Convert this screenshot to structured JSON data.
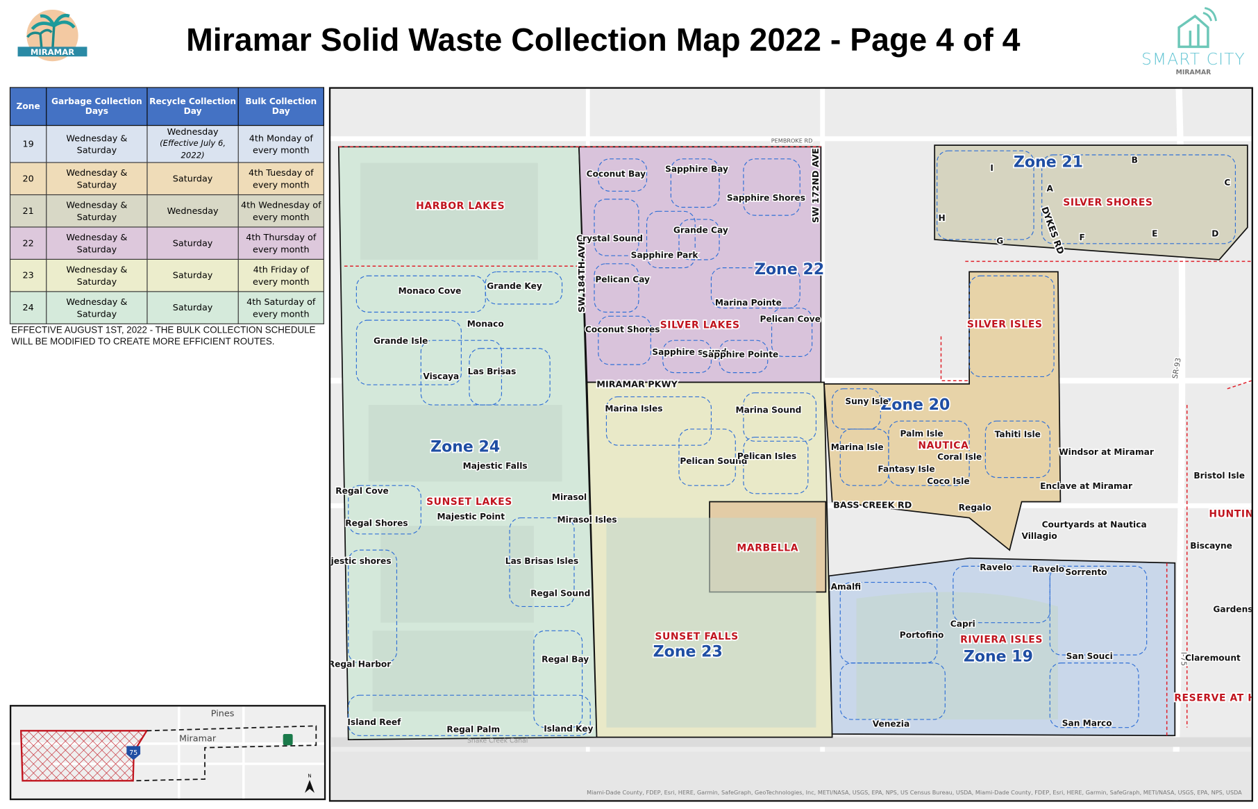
{
  "header": {
    "title": "Miramar Solid Waste Collection Map 2022 - Page 4 of 4",
    "left_logo_text": "MIRAMAR",
    "right_logo_text": "SMART CITY",
    "right_logo_subtext": "MIRAMAR"
  },
  "schedule_table": {
    "columns": [
      "Zone",
      "Garbage Collection Days",
      "Recycle Collection Day",
      "Bulk Collection Day"
    ],
    "rows": [
      {
        "zone": "19",
        "garbage": "Wednesday & Saturday",
        "recycle": "Wednesday",
        "recycle_note": "(Effective July 6, 2022)",
        "bulk": "4th Monday of every month",
        "color": "#dae3f0"
      },
      {
        "zone": "20",
        "garbage": "Wednesday & Saturday",
        "recycle": "Saturday",
        "bulk": "4th Tuesday of every month",
        "color": "#efdcb8"
      },
      {
        "zone": "21",
        "garbage": "Wednesday & Saturday",
        "recycle": "Wednesday",
        "bulk": "4th Wednesday of every month",
        "color": "#d8d8c6"
      },
      {
        "zone": "22",
        "garbage": "Wednesday & Saturday",
        "recycle": "Saturday",
        "bulk": "4th Thursday of every month",
        "color": "#ddc8dc"
      },
      {
        "zone": "23",
        "garbage": "Wednesday & Saturday",
        "recycle": "Saturday",
        "bulk": "4th Friday of every month",
        "color": "#ecedcc"
      },
      {
        "zone": "24",
        "garbage": "Wednesday & Saturday",
        "recycle": "Saturday",
        "bulk": "4th Saturday of every month",
        "color": "#d5eadb"
      }
    ],
    "header_color": "#4472c4"
  },
  "note": "EFFECTIVE AUGUST 1ST, 2022 - THE BULK COLLECTION SCHEDULE WILL BE MODIFIED TO CREATE MORE EFFICIENT ROUTES.",
  "map": {
    "zones": [
      "Zone 24",
      "Zone 22",
      "Zone 23",
      "Zone 20",
      "Zone 21",
      "Zone 19"
    ],
    "zone_colors": {
      "19": "#c9d7ea",
      "20": "#e7d3a8",
      "21": "#d6d4c0",
      "22": "#d9c3db",
      "23": "#e9e9c8",
      "24": "#d4e8da",
      "marbella": "#e3cca6"
    },
    "communities": [
      "HARBOR LAKES",
      "SILVER LAKES",
      "SUNSET LAKES",
      "NAUTICA",
      "SILVER ISLES",
      "SILVER SHORES",
      "MARBELLA",
      "SUNSET FALLS",
      "RIVIERA ISLES",
      "HUNTIN",
      "RESERVE AT H"
    ],
    "roads": [
      "MIRAMAR PKWY",
      "SW 184TH AVE",
      "SW 172ND AVE",
      "DYKES RD",
      "BASS CREEK RD",
      "PEMBROKE RD",
      "SR-93",
      "I-75"
    ],
    "neighborhoods": [
      "Coconut Bay",
      "Sapphire Bay",
      "Sapphire Shores",
      "Crystal Sound",
      "Grande Cay",
      "Sapphire Park",
      "Pelican Cay",
      "Marina Pointe",
      "Pelican Cove",
      "Coconut Shores",
      "Sapphire sound",
      "Sapphire Pointe",
      "Monaco Cove",
      "Grande Key",
      "Monaco",
      "Grande Isle",
      "Viscaya",
      "Las Brisas",
      "Majestic Falls",
      "Regal Cove",
      "Mirasol",
      "Majestic Point",
      "Mirasol Isles",
      "Regal Shores",
      "Majestic shores",
      "Las Brisas Isles",
      "Regal Sound",
      "Regal Harbor",
      "Regal Bay",
      "Island Reef",
      "Regal Palm",
      "Island Key",
      "Marina Isles",
      "Marina Sound",
      "Pelican Sound",
      "Pelican Isles",
      "Suny Isle",
      "Palm Isle",
      "Tahiti Isle",
      "Marina Isle",
      "Coral Isle",
      "Fantasy Isle",
      "Coco Isle",
      "Regalo",
      "Amalfi",
      "Ravelo",
      "Ravelo",
      "Sorrento",
      "Portofino",
      "Capri",
      "San Souci",
      "Venezia",
      "San Marco",
      "Villagio",
      "Windsor at Miramar",
      "Enclave at Miramar",
      "Courtyards at Nautica",
      "Bristol Isle",
      "Biscayne",
      "Gardens",
      "Claremount"
    ],
    "zone21_sections": [
      "A",
      "B",
      "C",
      "D",
      "E",
      "F",
      "G",
      "H",
      "I"
    ],
    "canal": "Snake Creek Canal",
    "attribution": "Miami-Dade County, FDEP, Esri, HERE, Garmin, SafeGraph, GeoTechnologies, Inc, METI/NASA, USGS, EPA, NPS, US Census Bureau, USDA, Miami-Dade County, FDEP, Esri, HERE, Garmin, SafeGraph, METI/NASA, USGS, EPA, NPS, USDA"
  },
  "inset": {
    "labels": [
      "Pines",
      "Miramar",
      "75",
      "N"
    ]
  }
}
